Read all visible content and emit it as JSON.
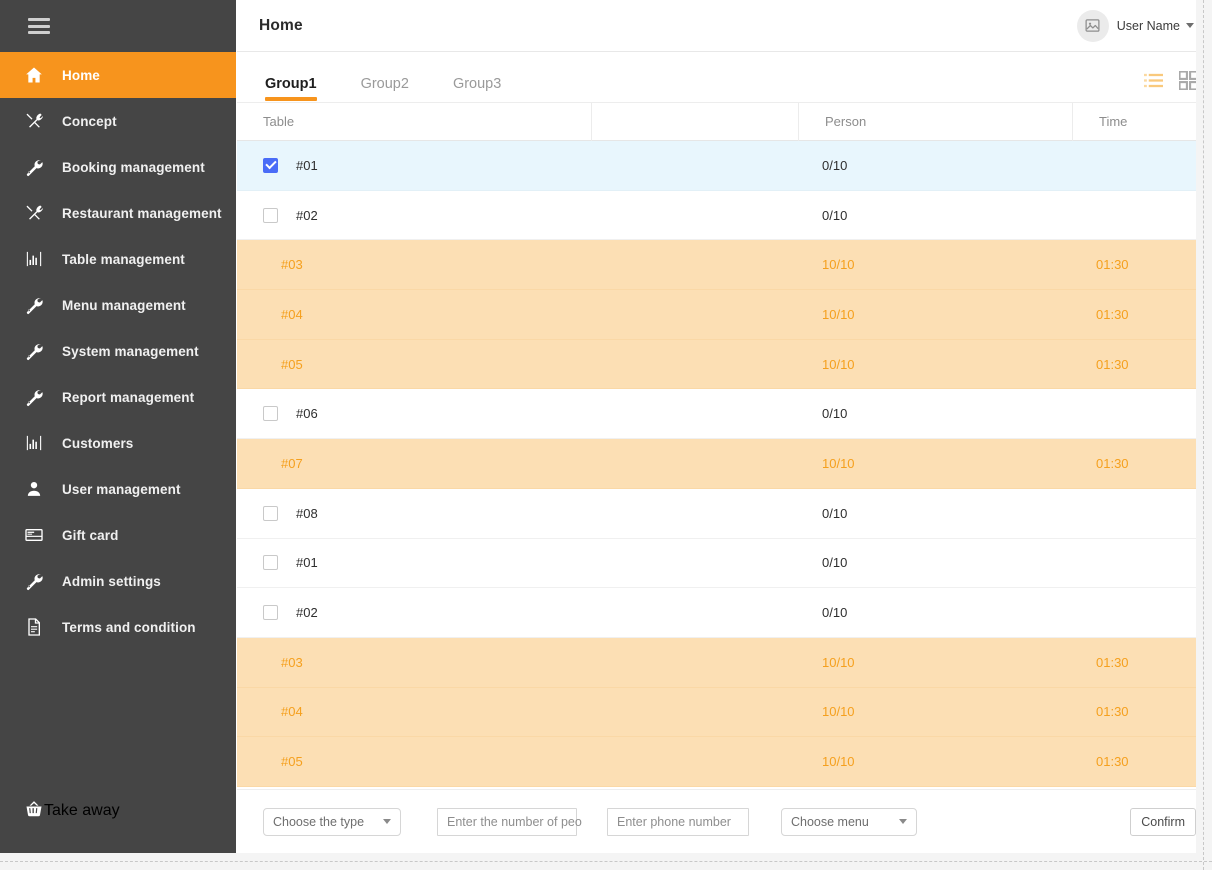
{
  "colors": {
    "accent": "#f7941d",
    "sidebar_bg": "#454545",
    "busy_row_bg": "#fcdfb4",
    "busy_text": "#f5a01e",
    "selected_row_bg": "#e8f6fd",
    "checkbox_checked": "#4a6cf7"
  },
  "sidebar": {
    "menu_icon": "hamburger-icon",
    "items": [
      {
        "label": "Home",
        "icon": "home-icon",
        "active": true
      },
      {
        "label": "Concept",
        "icon": "cutlery-icon",
        "active": false
      },
      {
        "label": "Booking management",
        "icon": "wrench-icon",
        "active": false
      },
      {
        "label": "Restaurant management",
        "icon": "cutlery-icon",
        "active": false
      },
      {
        "label": "Table management",
        "icon": "chart-icon",
        "active": false
      },
      {
        "label": "Menu management",
        "icon": "wrench-icon",
        "active": false
      },
      {
        "label": "System management",
        "icon": "wrench-icon",
        "active": false
      },
      {
        "label": "Report management",
        "icon": "wrench-icon",
        "active": false
      },
      {
        "label": "Customers",
        "icon": "chart-icon",
        "active": false
      },
      {
        "label": "User management",
        "icon": "person-icon",
        "active": false
      },
      {
        "label": "Gift card",
        "icon": "card-icon",
        "active": false
      },
      {
        "label": "Admin settings",
        "icon": "wrench-icon",
        "active": false
      },
      {
        "label": "Terms and condition",
        "icon": "document-icon",
        "active": false
      }
    ],
    "bottom_item": {
      "label": "Take away",
      "icon": "basket-icon"
    }
  },
  "topbar": {
    "title": "Home",
    "user": {
      "name": "User Name",
      "avatar_icon": "image-placeholder-icon",
      "caret_icon": "chevron-down-icon"
    }
  },
  "tabs": [
    {
      "label": "Group1",
      "active": true
    },
    {
      "label": "Group2",
      "active": false
    },
    {
      "label": "Group3",
      "active": false
    }
  ],
  "view_toggles": [
    {
      "name": "list-view",
      "icon": "list-icon",
      "active": true
    },
    {
      "name": "grid-view",
      "icon": "grid-icon",
      "active": false
    }
  ],
  "table": {
    "columns": [
      "Table",
      "",
      "Person",
      "Time"
    ],
    "rows": [
      {
        "table": "#01",
        "person": "0/10",
        "time": "",
        "state": "selected",
        "checkbox": "checked"
      },
      {
        "table": "#02",
        "person": "0/10",
        "time": "",
        "state": "free",
        "checkbox": "unchecked"
      },
      {
        "table": "#03",
        "person": "10/10",
        "time": "01:30",
        "state": "busy",
        "checkbox": "none"
      },
      {
        "table": "#04",
        "person": "10/10",
        "time": "01:30",
        "state": "busy",
        "checkbox": "none"
      },
      {
        "table": "#05",
        "person": "10/10",
        "time": "01:30",
        "state": "busy",
        "checkbox": "none"
      },
      {
        "table": "#06",
        "person": "0/10",
        "time": "",
        "state": "free",
        "checkbox": "unchecked"
      },
      {
        "table": "#07",
        "person": "10/10",
        "time": "01:30",
        "state": "busy",
        "checkbox": "none"
      },
      {
        "table": "#08",
        "person": "0/10",
        "time": "",
        "state": "free",
        "checkbox": "unchecked"
      },
      {
        "table": "#01",
        "person": "0/10",
        "time": "",
        "state": "free",
        "checkbox": "unchecked"
      },
      {
        "table": "#02",
        "person": "0/10",
        "time": "",
        "state": "free",
        "checkbox": "unchecked"
      },
      {
        "table": "#03",
        "person": "10/10",
        "time": "01:30",
        "state": "busy",
        "checkbox": "none"
      },
      {
        "table": "#04",
        "person": "10/10",
        "time": "01:30",
        "state": "busy",
        "checkbox": "none"
      },
      {
        "table": "#05",
        "person": "10/10",
        "time": "01:30",
        "state": "busy",
        "checkbox": "none"
      }
    ]
  },
  "footer": {
    "type_select": {
      "value": "Choose the type",
      "caret": "chevron-down-icon"
    },
    "people_input": {
      "placeholder": "Enter the number of peo",
      "value": ""
    },
    "phone_input": {
      "placeholder": "Enter phone number",
      "value": ""
    },
    "menu_select": {
      "value": "Choose menu",
      "caret": "chevron-down-icon"
    },
    "confirm_label": "Confirm"
  }
}
